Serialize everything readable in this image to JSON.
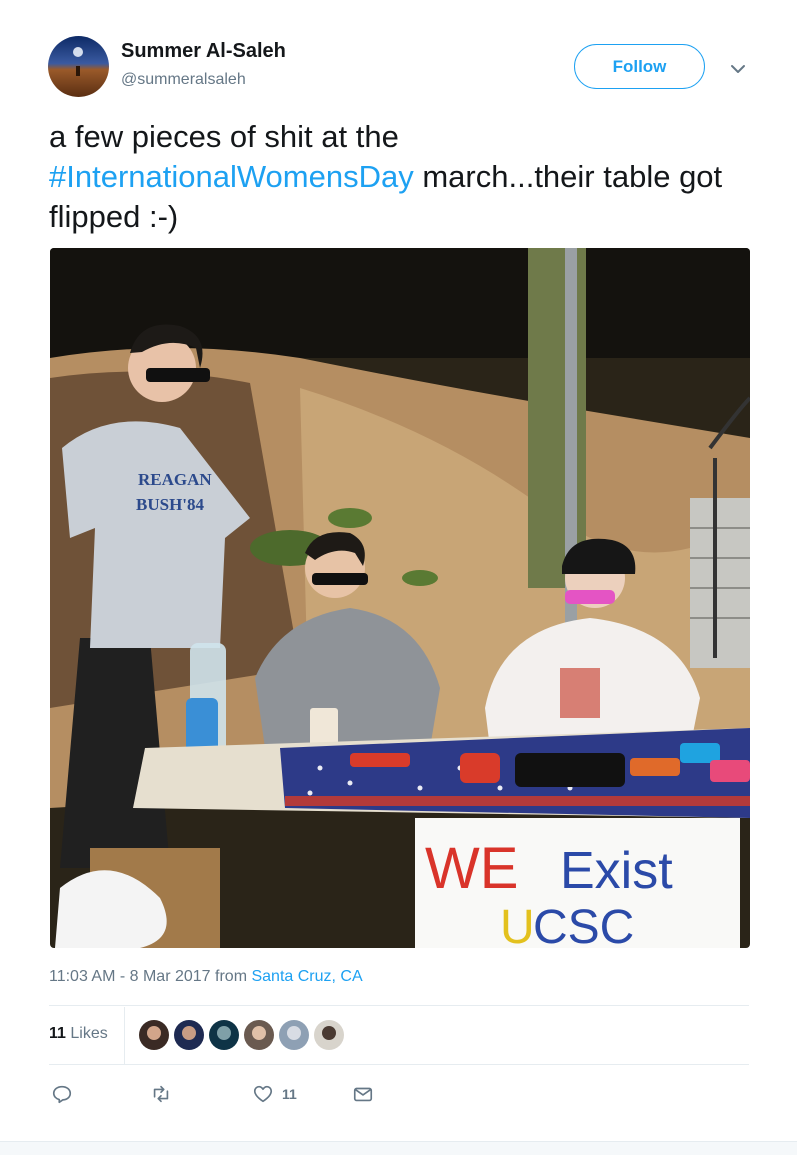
{
  "user": {
    "name": "Summer Al-Saleh",
    "handle": "@summeralsaleh"
  },
  "follow_label": "Follow",
  "tweet": {
    "text_before": "a few pieces of shit at the ",
    "hashtag": "#InternationalWomensDay",
    "text_after": " march...their table got flipped :-)"
  },
  "photo": {
    "shirt_text_1": "REAGAN",
    "shirt_text_2": "BUSH'84",
    "sign_line_1_we": "WE",
    "sign_line_1_exist": "Exist",
    "sign_line_2_u": "U",
    "sign_line_2_csc": "CSC"
  },
  "meta": {
    "time": "11:03 AM - 8 Mar 2017",
    "from": " from ",
    "location": "Santa Cruz, CA"
  },
  "likes": {
    "count": "11",
    "label": "Likes"
  },
  "actions": {
    "like_count": "11"
  },
  "colors": {
    "accent": "#1da1f2",
    "secondary_text": "#657786"
  }
}
